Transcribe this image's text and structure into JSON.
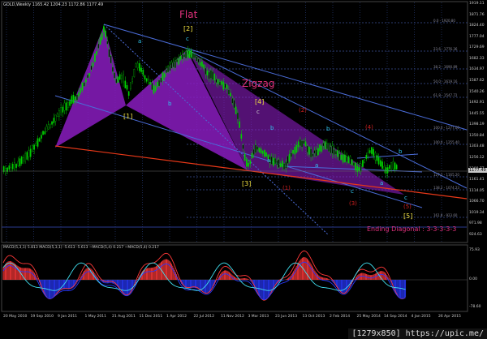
{
  "window": {
    "title": "GOLD,Weekly  1165.42 1204.23 1172.86 1177.49",
    "current_price_label": "1177.49"
  },
  "price_axis": {
    "labels": [
      "1919.11",
      "1871.76",
      "1824.40",
      "1777.04",
      "1729.69",
      "1682.33",
      "1634.97",
      "1587.62",
      "1540.26",
      "1492.91",
      "1445.55",
      "1398.19",
      "1350.84",
      "1303.48",
      "1256.12",
      "1208.77",
      "1161.41",
      "1114.05",
      "1066.70",
      "1019.34",
      "971.98",
      "924.63"
    ]
  },
  "time_axis": {
    "labels": [
      "20 May 2010",
      "19 Sep 2010",
      "9 Jan 2011",
      "1 May 2011",
      "21 Aug 2011",
      "11 Dec 2011",
      "1 Apr 2012",
      "22 Jul 2012",
      "11 Nov 2012",
      "3 Mar 2013",
      "23 Jun 2013",
      "13 Oct 2013",
      "2 Feb 2014",
      "25 May 2014",
      "14 Sep 2014",
      "4 Jan 2015",
      "26 Apr 2015"
    ]
  },
  "annotations": {
    "flat": "Flat",
    "zigzag": "Zigzag",
    "ending_diagonal": "Ending Diagonal : 3-3-3-3-3",
    "wave_1": "[1]",
    "wave_2": "[2]",
    "wave_3": "[3]",
    "wave_4": "[4]",
    "wave_5": "[5]",
    "sub_a1": "a",
    "sub_b1": "b",
    "sub_c1": "c",
    "sub_c_zz": "c",
    "sub_a_zz": "a",
    "sub_b_zz": "b",
    "sub_1": "(1)",
    "sub_2": "(2)",
    "sub_3": "(3)",
    "sub_4": "(4)",
    "sub_5": "(5)",
    "sub_c_end": "c",
    "sub_a_end": "a",
    "sub_b_end": "b",
    "ending_a": "a",
    "ending_b": "b",
    "ending_c": "c"
  },
  "fib_levels": [
    {
      "label": "0.0 - 1920.80"
    },
    {
      "label": "23.6 - 1776.36"
    },
    {
      "label": "38.2 - 1690.89"
    },
    {
      "label": "50.0 - 1619.16"
    },
    {
      "label": "61.8 - 1547.72"
    },
    {
      "label": "100.0 - 1277.00"
    },
    {
      "label": "100.0 - 1255.40"
    },
    {
      "label": "127.2 - 1165.20"
    },
    {
      "label": "138.2 - 1074.23"
    },
    {
      "label": "161.8 - 923.60"
    }
  ],
  "macd_panel": {
    "title": "MACD(5,3,1) 5.813  MACD(5,3,1) -5.613  -5.613  ~MACD(5,4) 0.217  ~MACD(5,4) 0.217",
    "axis_labels": [
      "75.93",
      "0.00",
      "-78.60"
    ]
  },
  "watermark": "[1279x850] https://upic.me/",
  "colors": {
    "background": "#000000",
    "grid": "#1c2c54",
    "bull_candle": "#00d000",
    "bear_candle": "#00a000",
    "channel": "#4a6cd8",
    "trendline_red": "#e83818",
    "fill_purple": "#8a1cc0",
    "text_magenta": "#e0307c",
    "wave_yellow": "#f0e040",
    "wave_cyan": "#30c8f0",
    "wave_red": "#d02020",
    "macd_red": "#ff3838",
    "macd_blue": "#2838ff",
    "macd_cyan": "#40e0f0"
  }
}
